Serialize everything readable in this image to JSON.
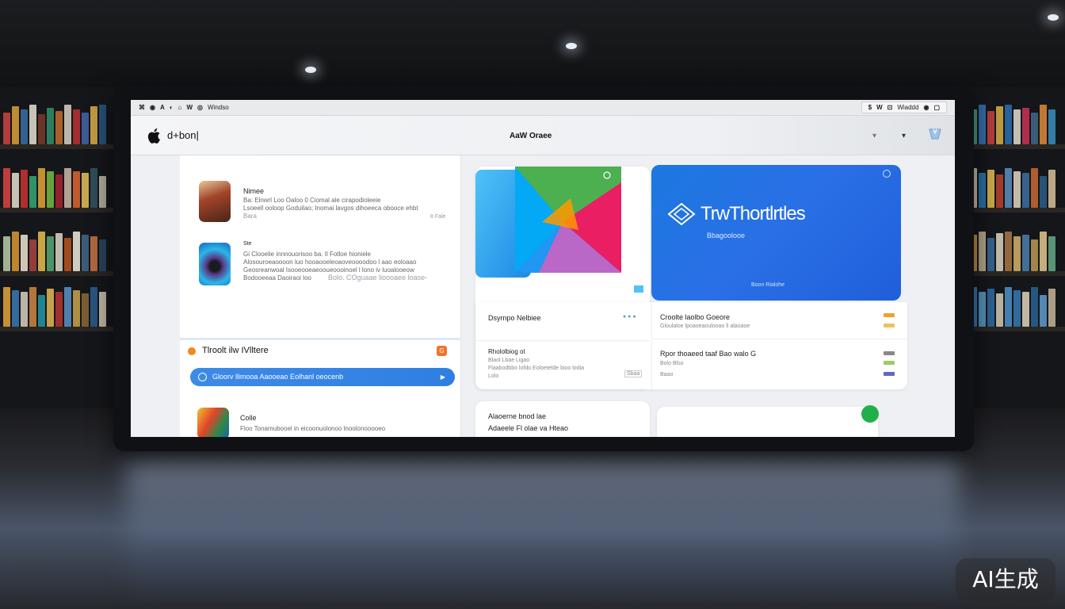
{
  "menubar": {
    "left_items": [
      "⌘",
      "◉",
      "A",
      "◐",
      "⌂",
      "W",
      "◎",
      "Windso"
    ],
    "right_items": [
      "$",
      "W",
      "⊡",
      "Wiaddd",
      "◉",
      "▢"
    ]
  },
  "titlebar": {
    "app_name": "d+bon|",
    "window_title": "AaW Oraee",
    "control_a": "▾",
    "control_b": "▾"
  },
  "list": {
    "items": [
      {
        "name": "Nimee",
        "lines": [
          "Ba: Elnwrl Loo Oaloo 0 Ciomal ale cirapodioleeie",
          "Lsoeell ooloop Goduilao; Inomai lavgos dihoeeca obooce ehbt",
          "Bara"
        ],
        "meta": "8 Fale"
      },
      {
        "name": "Ste",
        "lines": [
          "Gi Clooelie innnouorisoo ba. Il Fotloe hioniele",
          "Alosouroeaoooon luo hooaooeleoaoveoooodoo l aao eoloaao",
          "Geosreanwoal Isooeooeaeooueoooinoel l lono iv luoalooeow",
          "Bodooeeaa Daoiraoi loo",
          "Bolo. COguaae lioooaee loase-"
        ]
      }
    ],
    "section_title": "Tlroolt  ilw  IVlltere",
    "section_badge": "G",
    "promo_text": "Gloorv llimooa Aaooeao Eolhanl oeocenb",
    "bottom_item": {
      "name": "Colle",
      "line": "Floo  Tonamubooel in eicoonuolonoo lnoolonooooeo"
    }
  },
  "hero_b": {
    "title": "TrwThortlrtles",
    "subtitle": "Bbagoolooe",
    "footer": "Boon Rialohe"
  },
  "rows_left": [
    {
      "title": "Dsyrnpo  Nelbiee",
      "sub": ""
    },
    {
      "title": "Rhololbiog  ol",
      "sub": "Blaol Lbae Ligao"
    },
    {
      "title": "",
      "sub": "Flaabodbbo lofdo Eoloetelde bioo lodia"
    }
  ],
  "rows_left_meta": {
    "tag": "Lolo",
    "count": "Sbaa"
  },
  "rows_right": [
    {
      "title": "Croolte laolbo Goeore",
      "sub": "Gloulaloe lpoaoeaoulooao ll alaoaoe"
    },
    {
      "title": "Rpor thoaeed taaf Bao walo G",
      "sub": "Bolo Blso"
    },
    {
      "title": "",
      "sub": "Baao"
    }
  ],
  "bottom_card": {
    "line1": "Alaoerne bnod  lae",
    "line2": "Adaeele  Fl  olae va  Hteao"
  },
  "watermark": "AI生成",
  "colors": {
    "accent_blue": "#2f7fe3",
    "banner_blue": "#1c78e0",
    "section_orange": "#f08a1c"
  }
}
